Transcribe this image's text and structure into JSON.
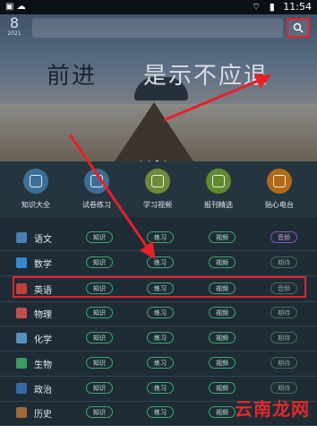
{
  "status_bar": {
    "time": "11:54",
    "left_icons": "▣ ☁",
    "wifi_icon": "wifi-icon",
    "battery_icon": "battery-icon"
  },
  "hero": {
    "date_day": "8",
    "date_month": "2021",
    "slogan": "前进",
    "slogan_right": "是示不应退",
    "search_placeholder": ""
  },
  "quick_nav": [
    {
      "label": "知识大全",
      "icon": "book-icon",
      "color": "#3d6e96"
    },
    {
      "label": "试卷练习",
      "icon": "paper-icon",
      "color": "#3d6e96"
    },
    {
      "label": "学习视频",
      "icon": "video-icon",
      "color": "#6e8a3a"
    },
    {
      "label": "报刊精选",
      "icon": "newspaper-icon",
      "color": "#5f8a2e"
    },
    {
      "label": "贴心电台",
      "icon": "radio-icon",
      "color": "#b06a1a"
    }
  ],
  "subject_buttons": {
    "knowledge": "知识",
    "practice": "练习",
    "video": "视频",
    "extra_listen": "音频",
    "extra_other": "期待"
  },
  "subjects": [
    {
      "name": "语文",
      "icon_color": "#4a7fb0",
      "extra": "音频",
      "extra_style": "purple"
    },
    {
      "name": "数学",
      "icon_color": "#3a86c8",
      "extra": "期待",
      "extra_style": "muted"
    },
    {
      "name": "英语",
      "icon_color": "#c04040",
      "extra": "音频",
      "extra_style": "muted"
    },
    {
      "name": "物理",
      "icon_color": "#c05050",
      "extra": "期待",
      "extra_style": "muted"
    },
    {
      "name": "化学",
      "icon_color": "#5a8fc0",
      "extra": "期待",
      "extra_style": "muted"
    },
    {
      "name": "生物",
      "icon_color": "#3a9a60",
      "extra": "期待",
      "extra_style": "muted"
    },
    {
      "name": "政治",
      "icon_color": "#3a6aa0",
      "extra": "期待",
      "extra_style": "muted"
    },
    {
      "name": "历史",
      "icon_color": "#9a6a3a",
      "extra": "期待",
      "extra_style": "muted"
    }
  ],
  "annotation_color": "#e8202a",
  "watermark": "云南龙网"
}
